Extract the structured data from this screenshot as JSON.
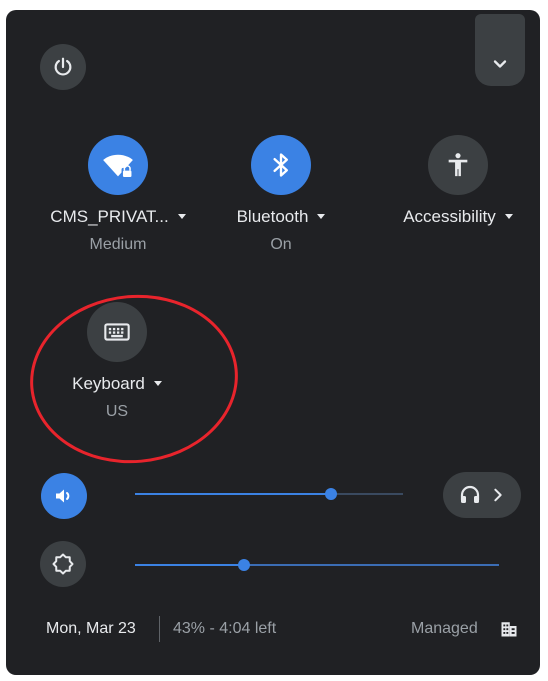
{
  "header": {
    "power_icon": "power-icon",
    "collapse_icon": "chevron-down-icon"
  },
  "pods": [
    {
      "icon": "wifi-locked-icon",
      "label": "CMS_PRIVAT...",
      "sublabel": "Medium",
      "active": true
    },
    {
      "icon": "bluetooth-icon",
      "label": "Bluetooth",
      "sublabel": "On",
      "active": true
    },
    {
      "icon": "accessibility-icon",
      "label": "Accessibility",
      "sublabel": "",
      "active": false
    },
    {
      "icon": "keyboard-icon",
      "label": "Keyboard",
      "sublabel": "US",
      "active": false
    }
  ],
  "volume": {
    "icon": "volume-icon",
    "level": 0.73,
    "output_icon": "headphones-icon"
  },
  "brightness": {
    "icon": "brightness-icon",
    "level": 0.3
  },
  "footer": {
    "date": "Mon, Mar 23",
    "battery": "43% - 4:04 left",
    "managed": "Managed",
    "managed_icon": "building-icon"
  },
  "annotation": {
    "color": "#e8242c",
    "shape": "ellipse"
  },
  "colors": {
    "panel_bg": "#202124",
    "accent": "#3b82e4",
    "button_bg": "#3c4043",
    "text_primary": "#e8eaed",
    "text_secondary": "#9aa0a6"
  }
}
